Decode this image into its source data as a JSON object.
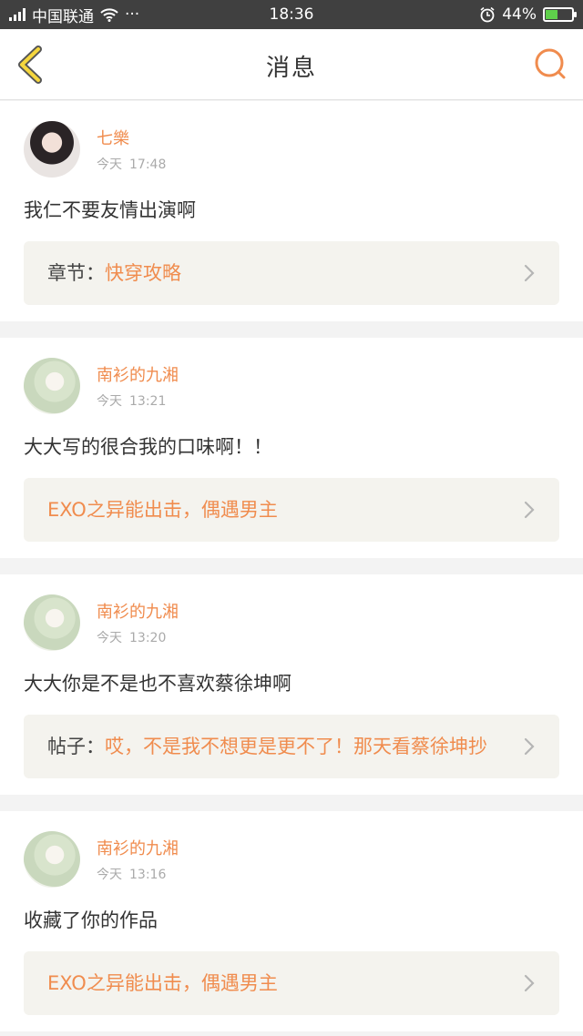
{
  "status_bar": {
    "carrier": "中国联通",
    "time": "18:36",
    "battery": "44%",
    "battery_level": 0.44
  },
  "nav": {
    "title": "消息",
    "back_icon": "chevron-left-icon",
    "search_icon": "search-icon"
  },
  "colors": {
    "accent": "#f08c4e",
    "back_arrow": "#f5d63d"
  },
  "messages": [
    {
      "author": "七樂",
      "day": "今天",
      "time": "17:48",
      "comment": "我仁不要友情出演啊",
      "ref_prefix": "章节：",
      "ref_text": "快穿攻略"
    },
    {
      "author": "南衫的九湘",
      "day": "今天",
      "time": "13:21",
      "comment": "大大写的很合我的口味啊！！",
      "ref_prefix": "",
      "ref_text": "EXO之异能出击，偶遇男主"
    },
    {
      "author": "南衫的九湘",
      "day": "今天",
      "time": "13:20",
      "comment": "大大你是不是也不喜欢蔡徐坤啊",
      "ref_prefix": "帖子：",
      "ref_text": "哎，不是我不想更是更不了！那天看蔡徐坤抄"
    },
    {
      "author": "南衫的九湘",
      "day": "今天",
      "time": "13:16",
      "comment": "收藏了你的作品",
      "ref_prefix": "",
      "ref_text": "EXO之异能出击，偶遇男主"
    }
  ]
}
